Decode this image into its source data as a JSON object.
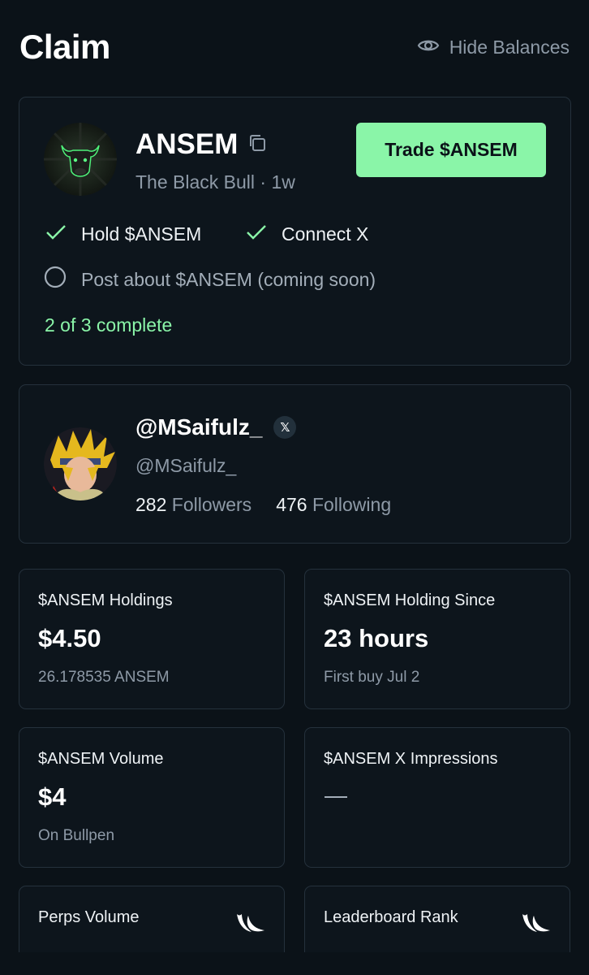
{
  "header": {
    "title": "Claim",
    "hide_balances_label": "Hide Balances",
    "hide_icon": "eye-icon"
  },
  "token": {
    "name": "ANSEM",
    "subtitle": "The Black Bull · 1w",
    "copy_icon": "copy-icon",
    "trade_button_label": "Trade $ANSEM",
    "tasks": [
      {
        "label": "Hold $ANSEM",
        "done": true
      },
      {
        "label": "Connect X",
        "done": true
      },
      {
        "label": "Post about $ANSEM (coming soon)",
        "done": false
      }
    ],
    "progress": "2 of 3 complete"
  },
  "profile": {
    "display_name": "@MSaifulz_",
    "handle": "@MSaifulz_",
    "x_badge": "𝕏",
    "followers_count": "282",
    "followers_label": "Followers",
    "following_count": "476",
    "following_label": "Following"
  },
  "stats": {
    "holdings": {
      "label": "$ANSEM Holdings",
      "value": "$4.50",
      "sub": "26.178535 ANSEM"
    },
    "since": {
      "label": "$ANSEM Holding Since",
      "value": "23 hours",
      "sub": "First buy Jul 2"
    },
    "volume": {
      "label": "$ANSEM Volume",
      "value": "$4",
      "sub": "On Bullpen"
    },
    "impressions": {
      "label": "$ANSEM X Impressions",
      "value": "—"
    },
    "perps": {
      "label": "Perps Volume",
      "icon": "bullpen-logo-icon"
    },
    "rank": {
      "label": "Leaderboard Rank",
      "icon": "bullpen-logo-icon"
    }
  },
  "colors": {
    "background": "#0b1218",
    "accent_green": "#8af5a8",
    "muted_text": "#8e9aa7",
    "border": "#25313c"
  }
}
